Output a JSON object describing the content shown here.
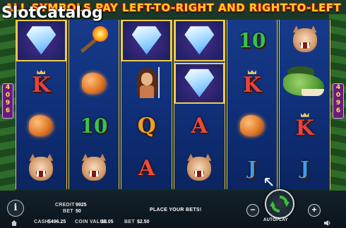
{
  "banner": {
    "text": "ALL SYMBOLS PAY LEFT-TO-RIGHT AND RIGHT-TO-LEFT"
  },
  "watermark": {
    "text": "SlotCatalog"
  },
  "ways": {
    "left": "4096",
    "right": "4096"
  },
  "reels": [
    [
      "diamond",
      "K",
      "rock",
      "tiger"
    ],
    [
      "torch",
      "rock",
      "10",
      "tiger"
    ],
    [
      "diamond",
      "woman",
      "Q",
      "A"
    ],
    [
      "diamond",
      "diamond",
      "A",
      "tiger"
    ],
    [
      "10",
      "K",
      "rock",
      "J"
    ],
    [
      "tiger",
      "dino",
      "K",
      "J"
    ]
  ],
  "framed_cells": [
    [
      0,
      0
    ],
    [
      2,
      0
    ],
    [
      3,
      0
    ],
    [
      3,
      1
    ]
  ],
  "symbol_colors": {
    "K": "#e8423a",
    "A": "#f04a36",
    "Q": "#f0a020",
    "J": "#3aa0f0",
    "10": "#39c24b"
  },
  "status": {
    "credit_label": "CREDIT",
    "credit_value": "9925",
    "bet_label": "BET",
    "bet_value": "50",
    "message": "PLACE YOUR BETS!",
    "cash_label": "CASH",
    "cash_value": "$496.25",
    "coin_value_label": "COIN VALUE",
    "coin_value_value": "$0.05",
    "bet_cash_label": "BET",
    "bet_cash_value": "$2.50"
  },
  "controls": {
    "info_label": "i",
    "minus_label": "−",
    "plus_label": "+",
    "autoplay_label": "AUTOPLAY",
    "spin_icon": "refresh-arrows-icon",
    "home_icon": "home-icon",
    "sound_icon": "speaker-icon"
  },
  "colors": {
    "banner": "#ffd21a",
    "spin_green": "#3dbb3d",
    "reel_bg": "#10307a",
    "frame_gold": "#e9c45a"
  }
}
